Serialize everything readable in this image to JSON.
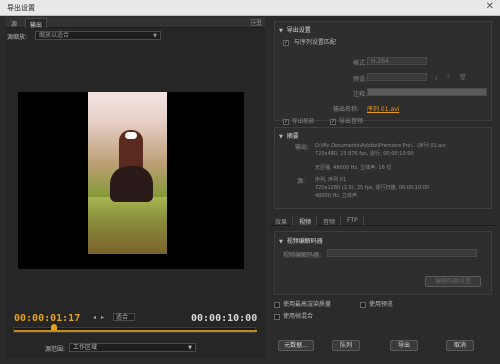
{
  "window": {
    "title": "导出设置",
    "close": "✕"
  },
  "left": {
    "tabs": [
      "源",
      "输出"
    ],
    "corner_button": "+全",
    "source_scaling": {
      "label": "源缩放:",
      "value": "缩放以适合"
    },
    "timecode_current": "00:00:01:17",
    "timecode_end": "00:00:10:00",
    "fit_value": "适合",
    "nav_icons": [
      "◂",
      "▸"
    ],
    "source_range": {
      "label": "源范围:",
      "value": "工作区域"
    },
    "playhead_fraction": 0.17
  },
  "right": {
    "export_settings": {
      "header": "导出设置",
      "match_sequence": {
        "label": "与序列设置匹配",
        "checked": true
      },
      "format": {
        "label": "格式:",
        "value": "H.264"
      },
      "preset": {
        "label": "预设:",
        "value": ""
      },
      "comment": {
        "label": "注释:",
        "value": ""
      },
      "output_name": {
        "label": "输出名称:",
        "value": "序列 01.avi"
      },
      "export_video": "导出视频",
      "export_audio": "导出音频"
    },
    "summary": {
      "header": "摘要",
      "output_label": "输出:",
      "output_lines": [
        "D:\\My Documents\\Adobe\\Premiere Pro\\...\\序列 01.avi",
        "720x480, 23.976 fps, 逐行, 00:00:10:00",
        "无压缩, 48000 Hz, 立体声, 16 位"
      ],
      "source_label": "源:",
      "source_lines": [
        "序列, 序列 01",
        "720x1280 (1.0), 25 fps, 逐行扫描, 00:00:10:00",
        "48000 Hz, 立体声"
      ]
    },
    "tabs": [
      "效果",
      "视频",
      "音频",
      "FTP"
    ],
    "video_codec": {
      "header": "视频编解码器",
      "label": "视频编解码器:",
      "value": "",
      "settings_button": "编解码器设置"
    },
    "options": [
      {
        "label": "使用最高渲染质量",
        "checked": false
      },
      {
        "label": "使用预览",
        "checked": false
      },
      {
        "label": "使用帧混合",
        "checked": false
      }
    ],
    "metadata_button": "元数据...",
    "queue_button": "队列",
    "export_button": "导出",
    "cancel_button": "取消"
  }
}
